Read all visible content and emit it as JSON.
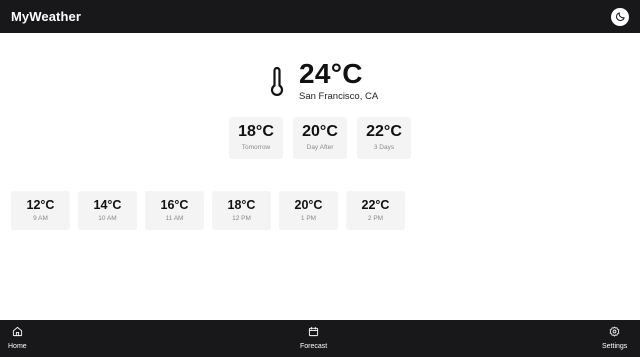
{
  "app": {
    "title": "MyWeather"
  },
  "current": {
    "temperature": "24°C",
    "location": "San Francisco, CA"
  },
  "daily": [
    {
      "temp": "18°C",
      "label": "Tomorrow"
    },
    {
      "temp": "20°C",
      "label": "Day After"
    },
    {
      "temp": "22°C",
      "label": "3 Days"
    }
  ],
  "hourly": [
    {
      "temp": "12°C",
      "label": "9 AM"
    },
    {
      "temp": "14°C",
      "label": "10 AM"
    },
    {
      "temp": "16°C",
      "label": "11 AM"
    },
    {
      "temp": "18°C",
      "label": "12 PM"
    },
    {
      "temp": "20°C",
      "label": "1 PM"
    },
    {
      "temp": "22°C",
      "label": "2 PM"
    }
  ],
  "nav": {
    "home": "Home",
    "forecast": "Forecast",
    "settings": "Settings"
  },
  "icons": {
    "theme_toggle": "moon-icon",
    "current": "thermometer-icon",
    "home": "home-icon",
    "forecast": "calendar-icon",
    "settings": "gear-icon"
  },
  "colors": {
    "bar_background": "#18181b",
    "card_background": "#f4f4f5",
    "card_label": "#8a8a8a"
  }
}
